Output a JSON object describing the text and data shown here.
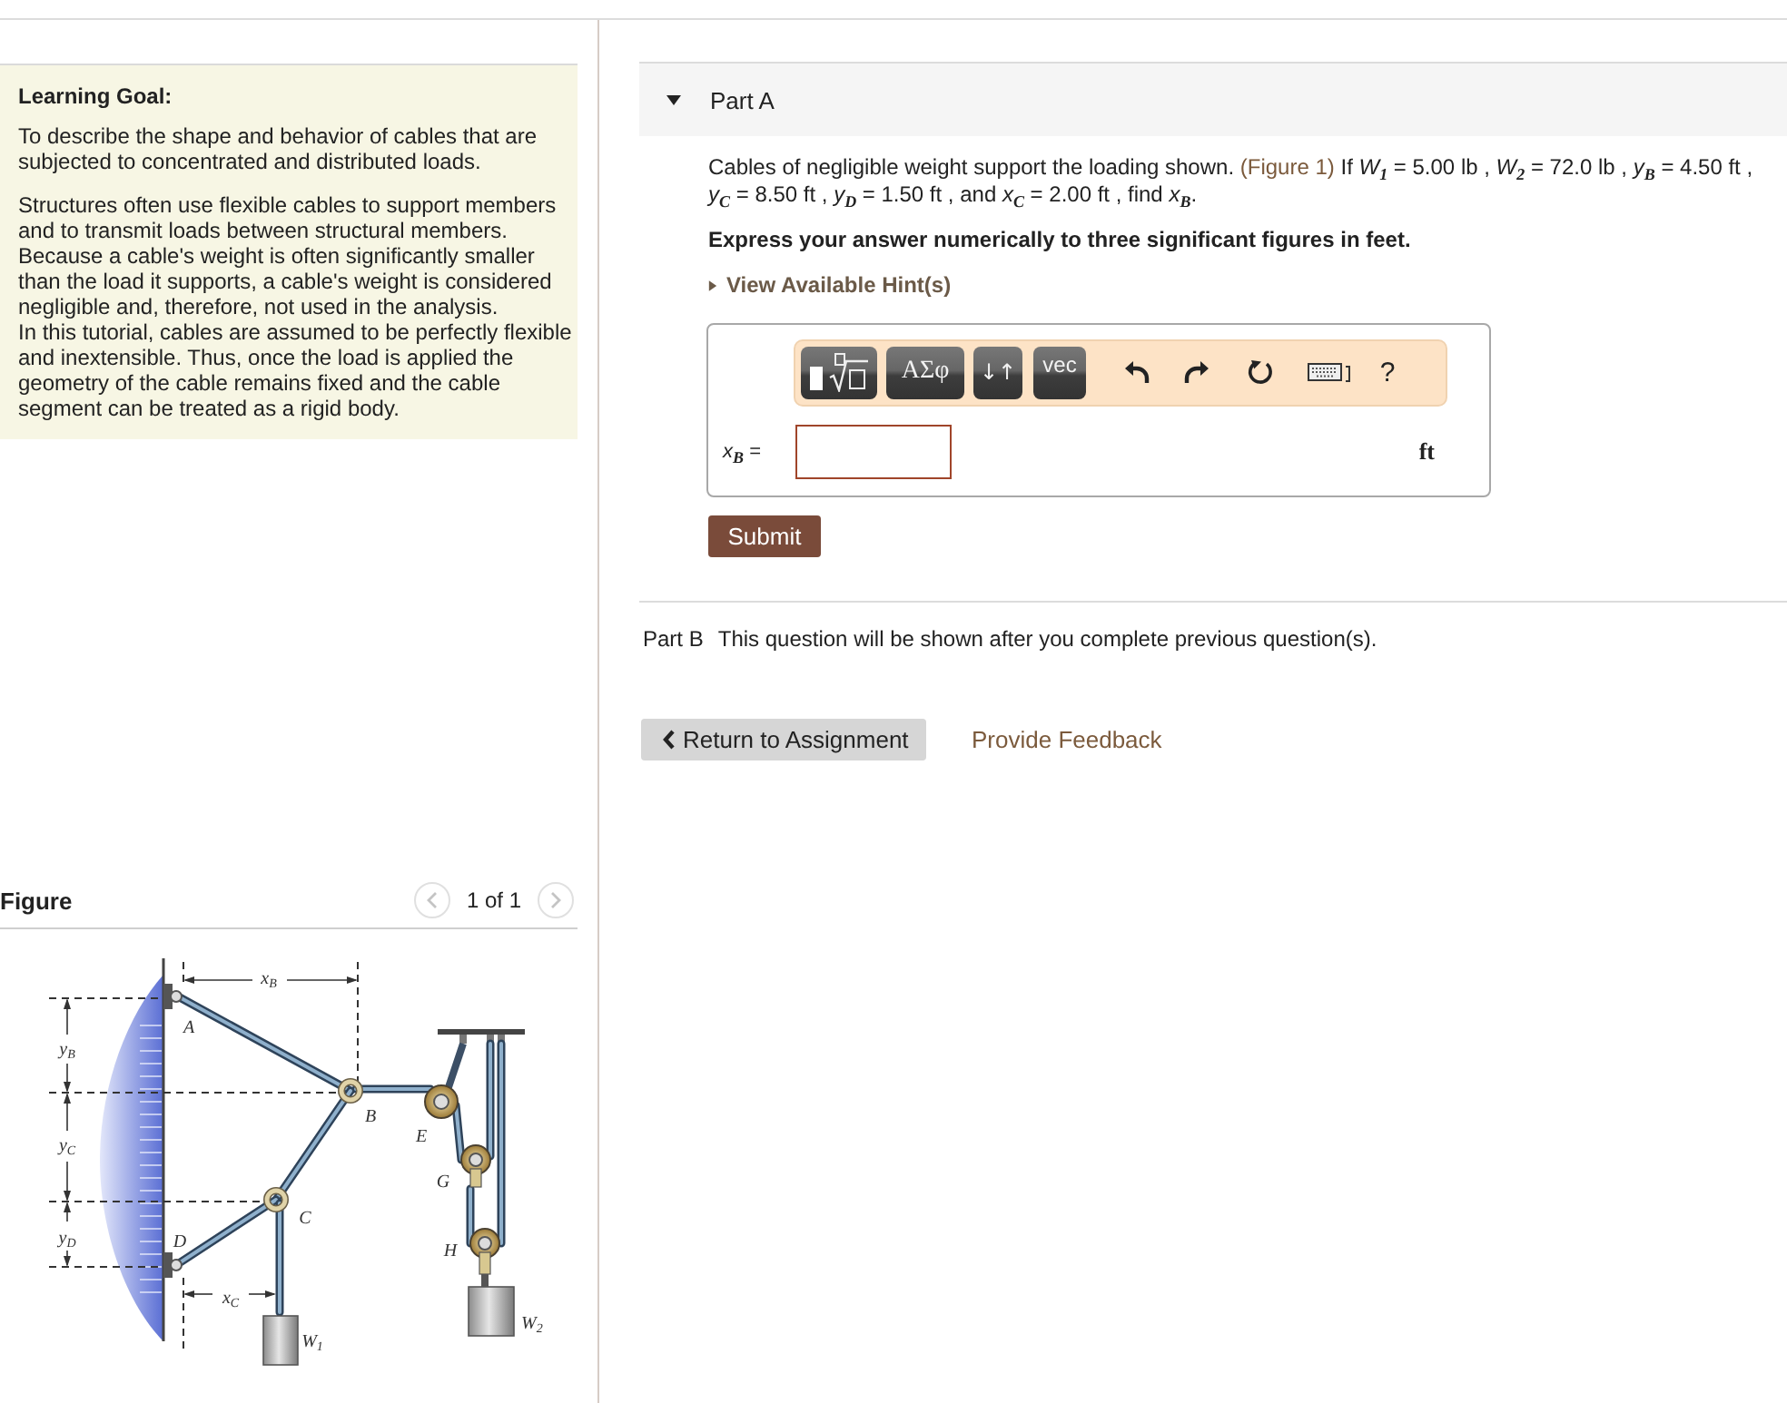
{
  "learning_goal": {
    "title": "Learning Goal:",
    "paragraphs": [
      "To describe the shape and behavior of cables that are subjected to concentrated and distributed loads.",
      "Structures often use flexible cables to support members and to transmit loads between structural members. Because a cable's weight is often significantly smaller than the load it supports, a cable's weight is considered negligible and, therefore, not used in the analysis.\nIn this tutorial, cables are assumed to be perfectly flexible and inextensible. Thus, once the load is applied the geometry of the cable remains fixed and the cable segment can be treated as a rigid body."
    ]
  },
  "figure": {
    "title": "Figure",
    "counter": "1 of 1",
    "previous": {
      "disabled": true
    },
    "next": {
      "disabled": true
    },
    "labels": [
      {
        "text": "y",
        "sub": "B"
      },
      {
        "text": "y",
        "sub": "C"
      },
      {
        "text": "y",
        "sub": "D"
      },
      {
        "text": "x",
        "sub": "B"
      },
      {
        "text": "x",
        "sub": "C"
      },
      {
        "text": "A"
      },
      {
        "text": "B"
      },
      {
        "text": "C"
      },
      {
        "text": "D"
      },
      {
        "text": "E"
      },
      {
        "text": "G"
      },
      {
        "text": "H"
      },
      {
        "text": "W",
        "sub": "1"
      },
      {
        "text": "W",
        "sub": "2"
      }
    ]
  },
  "part_a": {
    "title": "Part A",
    "expanded": true,
    "question": {
      "before": "Cables of negligible weight support the loading shown.",
      "link": "(Figure 1)",
      "after": "If *W*$_{1}$ = 5.00 lb , *W*$_{2}$ = 72.0 lb , *y*$_{B}$ = 4.50 ft , *y*$_{C}$ = 8.50 ft , *y*$_{D}$ = 1.50 ft , and *x*$_{C}$ = 2.00 ft , find *x*$_{B}$."
    },
    "instruction": "Express your answer numerically to three significant figures in feet.",
    "hint": {
      "label": "View Available Hint(s)",
      "expanded": false
    },
    "toolbar": {
      "buttons": [
        {
          "kind": "template"
        },
        {
          "kind": "symbols",
          "label": "ΑΣφ"
        },
        {
          "kind": "arrows",
          "label": "↓↑"
        },
        {
          "kind": "vector",
          "label": "vec"
        }
      ],
      "actions": [
        {
          "kind": "undo"
        },
        {
          "kind": "redo"
        },
        {
          "kind": "reset"
        },
        {
          "kind": "keyboard"
        },
        {
          "kind": "help",
          "label": "?"
        }
      ]
    },
    "answer": {
      "label": "*x*$_{B}$ =",
      "unit": "ft"
    },
    "submit": "Submit"
  },
  "part_b": {
    "title": "Part B",
    "message": "This question will be shown after you complete previous question(s)."
  },
  "footer": {
    "return": "Return to Assignment",
    "feedback": "Provide Feedback"
  }
}
